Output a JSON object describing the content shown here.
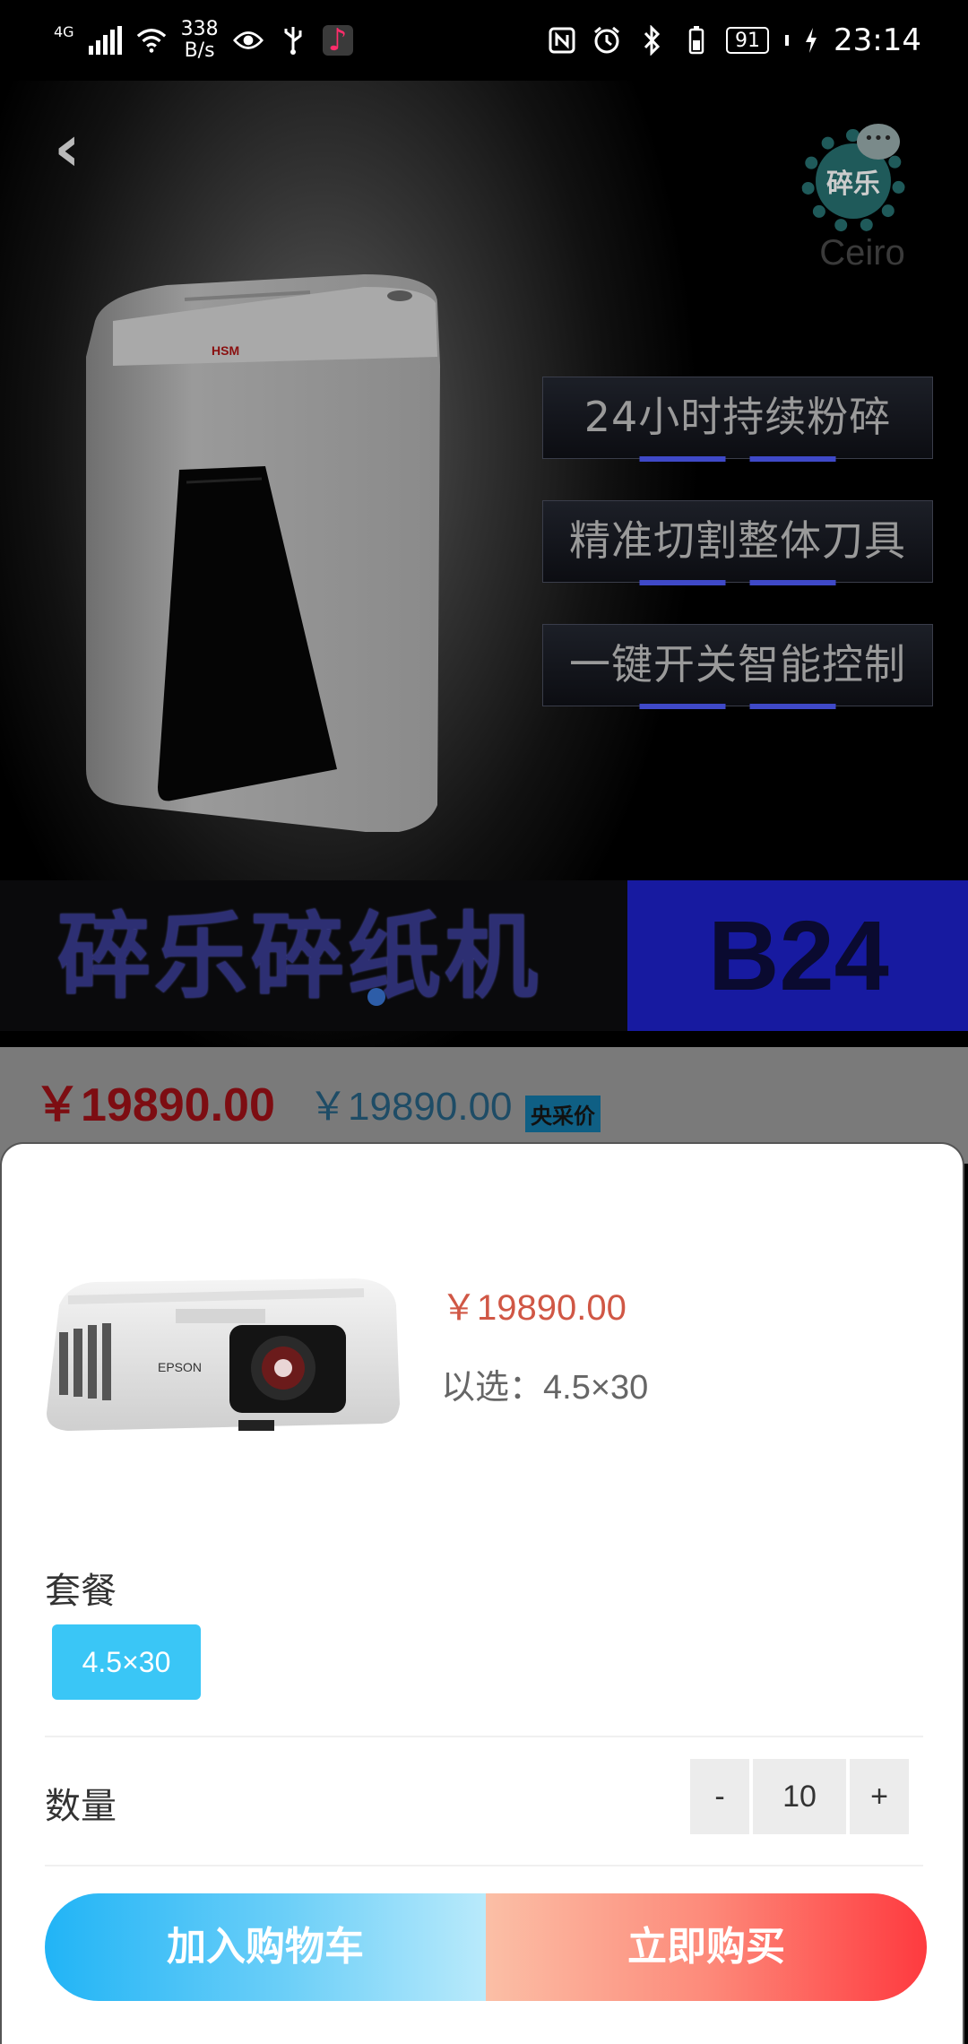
{
  "status_bar": {
    "network_badge": "4G",
    "speed_value": "338",
    "speed_unit": "B/s",
    "battery": "91",
    "time": "23:14"
  },
  "hero": {
    "logo_char": "碎乐",
    "logo_brand": "Ceiro",
    "features": [
      "24小时持续粉碎",
      "精准切割整体刀具",
      "一键开关智能控制"
    ],
    "brand_title": "碎乐碎纸机",
    "model": "B24",
    "shredder_brand": "HSM"
  },
  "price_row": {
    "price": "￥19890.00",
    "original_price": "￥19890.00",
    "tag": "央采价"
  },
  "sheet": {
    "price": "￥19890.00",
    "selected_text": "以选：4.5×30",
    "package_label": "套餐",
    "package_option": "4.5×30",
    "quantity_label": "数量",
    "qty_minus": "-",
    "qty_value": "10",
    "qty_plus": "+",
    "add_to_cart": "加入购物车",
    "buy_now": "立即购买"
  },
  "colors": {
    "accent_blue": "#3ac6f6",
    "price_red": "#d05745",
    "buy_red": "#fe3a3f"
  }
}
